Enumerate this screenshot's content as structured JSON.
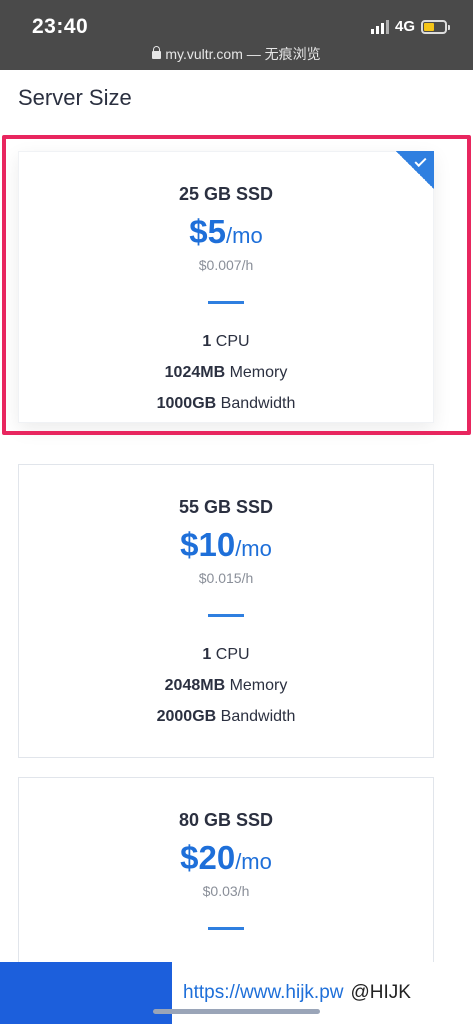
{
  "status_bar": {
    "time": "23:40",
    "network": "4G",
    "url": "my.vultr.com",
    "mode": " — 无痕浏览"
  },
  "section_title": "Server Size",
  "plans": [
    {
      "ssd": "25 GB SSD",
      "price": "$5",
      "period": "/mo",
      "hourly": "$0.007/h",
      "cpu_value": "1",
      "cpu_label": " CPU",
      "memory_value": "1024MB",
      "memory_label": " Memory",
      "bandwidth_value": "1000GB",
      "bandwidth_label": " Bandwidth",
      "selected": true
    },
    {
      "ssd": "55 GB SSD",
      "price": "$10",
      "period": "/mo",
      "hourly": "$0.015/h",
      "cpu_value": "1",
      "cpu_label": " CPU",
      "memory_value": "2048MB",
      "memory_label": " Memory",
      "bandwidth_value": "2000GB",
      "bandwidth_label": " Bandwidth",
      "selected": false
    },
    {
      "ssd": "80 GB SSD",
      "price": "$20",
      "period": "/mo",
      "hourly": "$0.03/h",
      "selected": false
    }
  ],
  "watermark": {
    "link": "https://www.hijk.pw",
    "handle": "@HIJK"
  },
  "colors": {
    "accent": "#1e6fd9",
    "highlight": "#e8265f",
    "bottom_bar": "#1c5fdc"
  }
}
